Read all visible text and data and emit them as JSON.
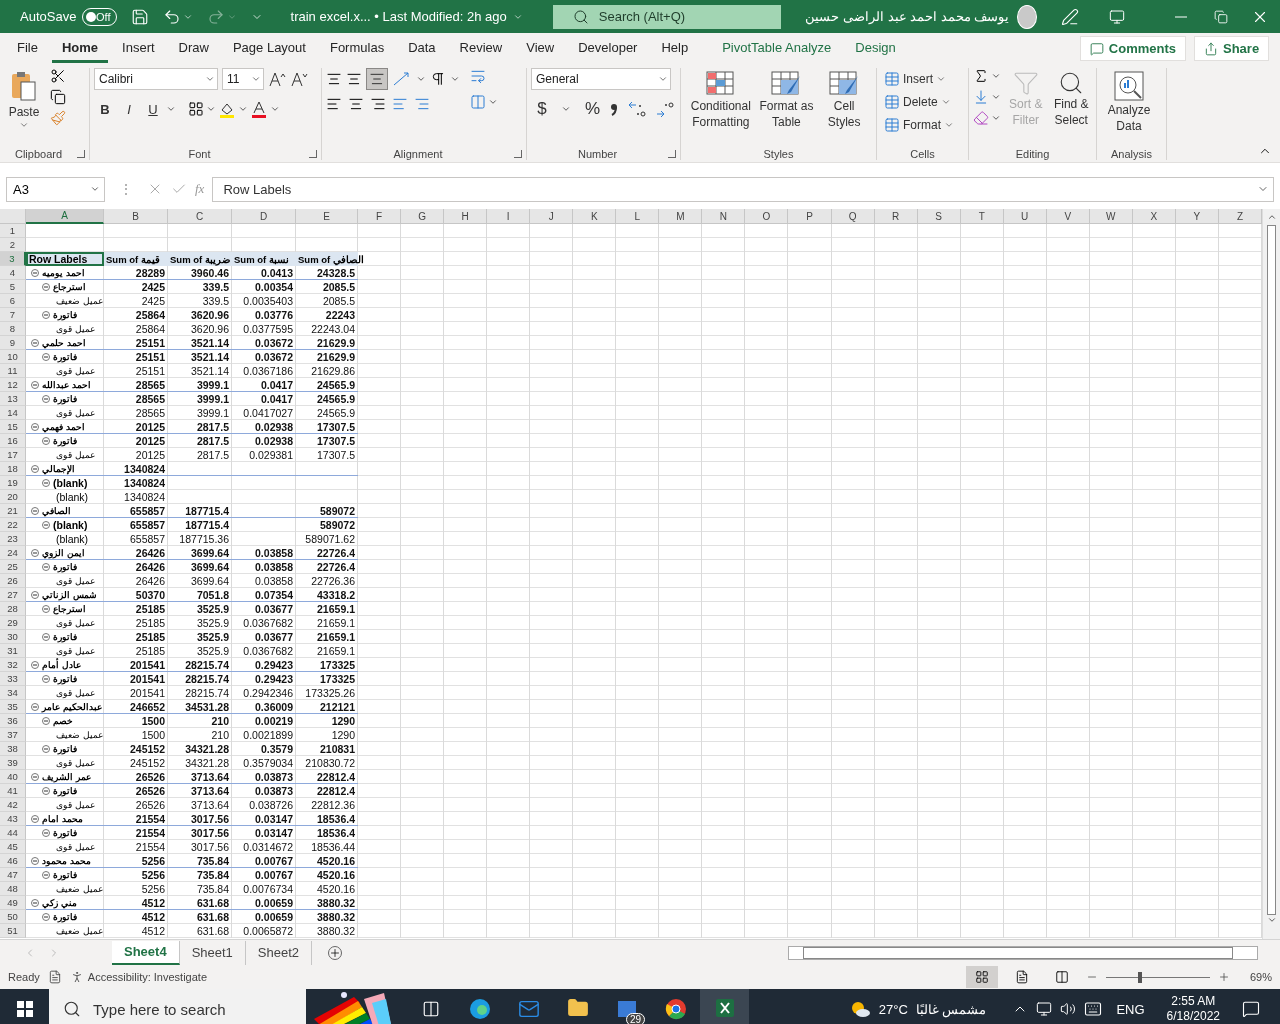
{
  "title_bar": {
    "autosave_label": "AutoSave",
    "autosave_on": false,
    "autosave_state": "Off",
    "file_title": "train excel.x... • Last Modified: 2h ago",
    "search_placeholder": "Search (Alt+Q)",
    "user_name": "يوسف محمد احمد عبد الراضى حسين"
  },
  "ribbon_tabs": [
    {
      "label": "File",
      "selected": false,
      "kind": "standard"
    },
    {
      "label": "Home",
      "selected": true,
      "kind": "standard"
    },
    {
      "label": "Insert",
      "selected": false,
      "kind": "standard"
    },
    {
      "label": "Draw",
      "selected": false,
      "kind": "standard"
    },
    {
      "label": "Page Layout",
      "selected": false,
      "kind": "standard"
    },
    {
      "label": "Formulas",
      "selected": false,
      "kind": "standard"
    },
    {
      "label": "Data",
      "selected": false,
      "kind": "standard"
    },
    {
      "label": "Review",
      "selected": false,
      "kind": "standard"
    },
    {
      "label": "View",
      "selected": false,
      "kind": "standard"
    },
    {
      "label": "Developer",
      "selected": false,
      "kind": "standard"
    },
    {
      "label": "Help",
      "selected": false,
      "kind": "standard"
    },
    {
      "label": "PivotTable Analyze",
      "selected": false,
      "kind": "contextual"
    },
    {
      "label": "Design",
      "selected": false,
      "kind": "contextual"
    }
  ],
  "ribbon_actions": [
    "Comments",
    "Share"
  ],
  "ribbon_groups": [
    {
      "kind": "clipboard",
      "title": "Clipboard",
      "paste": "Paste"
    },
    {
      "kind": "font",
      "title": "Font",
      "font": "Calibri",
      "size": "11",
      "bold": "B",
      "italic": "I",
      "underline": "U"
    },
    {
      "kind": "alignment",
      "title": "Alignment",
      "bottom_align_selected": true
    },
    {
      "kind": "number",
      "title": "Number",
      "format": "General",
      "currency": "$",
      "percent": "%"
    },
    {
      "kind": "styles",
      "title": "Styles",
      "buttons": [
        "Conditional Formatting",
        "Format as Table",
        "Cell Styles"
      ]
    },
    {
      "kind": "cells",
      "title": "Cells",
      "buttons": [
        "Insert",
        "Delete",
        "Format"
      ]
    },
    {
      "kind": "editing",
      "title": "Editing",
      "buttons": [
        {
          "label": "Sort & Filter",
          "disabled": true
        },
        {
          "label": "Find & Select",
          "disabled": false
        }
      ]
    },
    {
      "kind": "analysis",
      "title": "Analysis",
      "buttons": [
        "Analyze Data"
      ]
    }
  ],
  "formula_bar": {
    "name_box": "A3",
    "more": "⋮",
    "fx": "fx",
    "formula": "Row Labels"
  },
  "sheet": {
    "columns": [
      {
        "label": "A",
        "selected": true
      },
      {
        "label": "B",
        "selected": false
      },
      {
        "label": "C",
        "selected": false
      },
      {
        "label": "D",
        "selected": false
      },
      {
        "label": "E",
        "selected": false
      },
      {
        "label": "F",
        "selected": false
      },
      {
        "label": "G",
        "selected": false
      },
      {
        "label": "H",
        "selected": false
      },
      {
        "label": "I",
        "selected": false
      },
      {
        "label": "J",
        "selected": false
      },
      {
        "label": "K",
        "selected": false
      },
      {
        "label": "L",
        "selected": false
      },
      {
        "label": "M",
        "selected": false
      },
      {
        "label": "N",
        "selected": false
      },
      {
        "label": "O",
        "selected": false
      },
      {
        "label": "P",
        "selected": false
      },
      {
        "label": "Q",
        "selected": false
      },
      {
        "label": "R",
        "selected": false
      },
      {
        "label": "S",
        "selected": false
      },
      {
        "label": "T",
        "selected": false
      },
      {
        "label": "U",
        "selected": false
      },
      {
        "label": "V",
        "selected": false
      },
      {
        "label": "W",
        "selected": false
      },
      {
        "label": "X",
        "selected": false
      },
      {
        "label": "Y",
        "selected": false
      },
      {
        "label": "Z",
        "selected": false
      }
    ],
    "empty_rows": [
      "1",
      "2"
    ],
    "header_row": {
      "row": "3",
      "selected": true,
      "cells": [
        "Row Labels",
        "Sum of قيمة",
        "Sum of ضريبة",
        "Sum of نسبة",
        "Sum of الصافي"
      ]
    },
    "pivot_rows": [
      {
        "row": "4",
        "label": "احمد يوميه",
        "expanded": true,
        "values": {
          "B": "28289",
          "C": "3960.46",
          "D": "0.0413",
          "E": "24328.5"
        },
        "children": [
          {
            "row": "5",
            "label": "استرجاع",
            "expanded": true,
            "values": {
              "B": "2425",
              "C": "339.5",
              "D": "0.00354",
              "E": "2085.5"
            },
            "children": [
              {
                "row": "6",
                "label": "عميل ضعيف",
                "values": {
                  "B": "2425",
                  "C": "339.5",
                  "D": "0.0035403",
                  "E": "2085.5"
                }
              }
            ]
          },
          {
            "row": "7",
            "label": "فاتورة",
            "expanded": true,
            "values": {
              "B": "25864",
              "C": "3620.96",
              "D": "0.03776",
              "E": "22243"
            },
            "children": [
              {
                "row": "8",
                "label": "عميل قوى",
                "values": {
                  "B": "25864",
                  "C": "3620.96",
                  "D": "0.0377595",
                  "E": "22243.04"
                }
              }
            ]
          }
        ]
      },
      {
        "row": "9",
        "label": "احمد حلمي",
        "expanded": true,
        "values": {
          "B": "25151",
          "C": "3521.14",
          "D": "0.03672",
          "E": "21629.9"
        },
        "children": [
          {
            "row": "10",
            "label": "فاتورة",
            "expanded": true,
            "values": {
              "B": "25151",
              "C": "3521.14",
              "D": "0.03672",
              "E": "21629.9"
            },
            "children": [
              {
                "row": "11",
                "label": "عميل قوى",
                "values": {
                  "B": "25151",
                  "C": "3521.14",
                  "D": "0.0367186",
                  "E": "21629.86"
                }
              }
            ]
          }
        ]
      },
      {
        "row": "12",
        "label": "احمد عبدالله",
        "expanded": true,
        "values": {
          "B": "28565",
          "C": "3999.1",
          "D": "0.0417",
          "E": "24565.9"
        },
        "children": [
          {
            "row": "13",
            "label": "فاتورة",
            "expanded": true,
            "values": {
              "B": "28565",
              "C": "3999.1",
              "D": "0.0417",
              "E": "24565.9"
            },
            "children": [
              {
                "row": "14",
                "label": "عميل قوى",
                "values": {
                  "B": "28565",
                  "C": "3999.1",
                  "D": "0.0417027",
                  "E": "24565.9"
                }
              }
            ]
          }
        ]
      },
      {
        "row": "15",
        "label": "احمد فهمي",
        "expanded": true,
        "values": {
          "B": "20125",
          "C": "2817.5",
          "D": "0.02938",
          "E": "17307.5"
        },
        "children": [
          {
            "row": "16",
            "label": "فاتورة",
            "expanded": true,
            "values": {
              "B": "20125",
              "C": "2817.5",
              "D": "0.02938",
              "E": "17307.5"
            },
            "children": [
              {
                "row": "17",
                "label": "عميل قوى",
                "values": {
                  "B": "20125",
                  "C": "2817.5",
                  "D": "0.029381",
                  "E": "17307.5"
                }
              }
            ]
          }
        ]
      },
      {
        "row": "18",
        "label": "الإجمالي",
        "expanded": true,
        "values": {
          "B": "1340824"
        },
        "children": [
          {
            "row": "19",
            "label": "(blank)",
            "expanded": true,
            "values": {
              "B": "1340824"
            },
            "children": [
              {
                "row": "20",
                "label": "(blank)",
                "values": {
                  "B": "1340824"
                }
              }
            ]
          }
        ]
      },
      {
        "row": "21",
        "label": "الصافي",
        "expanded": true,
        "values": {
          "B": "655857",
          "C": "187715.4",
          "E": "589072"
        },
        "children": [
          {
            "row": "22",
            "label": "(blank)",
            "expanded": true,
            "values": {
              "B": "655857",
              "C": "187715.4",
              "E": "589072"
            },
            "children": [
              {
                "row": "23",
                "label": "(blank)",
                "values": {
                  "B": "655857",
                  "C": "187715.36",
                  "E": "589071.62"
                }
              }
            ]
          }
        ]
      },
      {
        "row": "24",
        "label": "ايمن الزوي",
        "expanded": true,
        "values": {
          "B": "26426",
          "C": "3699.64",
          "D": "0.03858",
          "E": "22726.4"
        },
        "children": [
          {
            "row": "25",
            "label": "فاتورة",
            "expanded": true,
            "values": {
              "B": "26426",
              "C": "3699.64",
              "D": "0.03858",
              "E": "22726.4"
            },
            "children": [
              {
                "row": "26",
                "label": "عميل قوى",
                "values": {
                  "B": "26426",
                  "C": "3699.64",
                  "D": "0.03858",
                  "E": "22726.36"
                }
              }
            ]
          }
        ]
      },
      {
        "row": "27",
        "label": "شمس الزناتي",
        "expanded": true,
        "values": {
          "B": "50370",
          "C": "7051.8",
          "D": "0.07354",
          "E": "43318.2"
        },
        "children": [
          {
            "row": "28",
            "label": "استرجاع",
            "expanded": true,
            "values": {
              "B": "25185",
              "C": "3525.9",
              "D": "0.03677",
              "E": "21659.1"
            },
            "children": [
              {
                "row": "29",
                "label": "عميل قوى",
                "values": {
                  "B": "25185",
                  "C": "3525.9",
                  "D": "0.0367682",
                  "E": "21659.1"
                }
              }
            ]
          },
          {
            "row": "30",
            "label": "فاتورة",
            "expanded": true,
            "values": {
              "B": "25185",
              "C": "3525.9",
              "D": "0.03677",
              "E": "21659.1"
            },
            "children": [
              {
                "row": "31",
                "label": "عميل قوى",
                "values": {
                  "B": "25185",
                  "C": "3525.9",
                  "D": "0.0367682",
                  "E": "21659.1"
                }
              }
            ]
          }
        ]
      },
      {
        "row": "32",
        "label": "عادل أمام",
        "expanded": true,
        "values": {
          "B": "201541",
          "C": "28215.74",
          "D": "0.29423",
          "E": "173325"
        },
        "children": [
          {
            "row": "33",
            "label": "فاتورة",
            "expanded": true,
            "values": {
              "B": "201541",
              "C": "28215.74",
              "D": "0.29423",
              "E": "173325"
            },
            "children": [
              {
                "row": "34",
                "label": "عميل قوى",
                "values": {
                  "B": "201541",
                  "C": "28215.74",
                  "D": "0.2942346",
                  "E": "173325.26"
                }
              }
            ]
          }
        ]
      },
      {
        "row": "35",
        "label": "عبدالحكيم عامر",
        "expanded": true,
        "values": {
          "B": "246652",
          "C": "34531.28",
          "D": "0.36009",
          "E": "212121"
        },
        "children": [
          {
            "row": "36",
            "label": "خصم",
            "expanded": true,
            "values": {
              "B": "1500",
              "C": "210",
              "D": "0.00219",
              "E": "1290"
            },
            "children": [
              {
                "row": "37",
                "label": "عميل ضعيف",
                "values": {
                  "B": "1500",
                  "C": "210",
                  "D": "0.0021899",
                  "E": "1290"
                }
              }
            ]
          },
          {
            "row": "38",
            "label": "فاتورة",
            "expanded": true,
            "values": {
              "B": "245152",
              "C": "34321.28",
              "D": "0.3579",
              "E": "210831"
            },
            "children": [
              {
                "row": "39",
                "label": "عميل قوى",
                "values": {
                  "B": "245152",
                  "C": "34321.28",
                  "D": "0.3579034",
                  "E": "210830.72"
                }
              }
            ]
          }
        ]
      },
      {
        "row": "40",
        "label": "عمر الشريف",
        "expanded": true,
        "values": {
          "B": "26526",
          "C": "3713.64",
          "D": "0.03873",
          "E": "22812.4"
        },
        "children": [
          {
            "row": "41",
            "label": "فاتورة",
            "expanded": true,
            "values": {
              "B": "26526",
              "C": "3713.64",
              "D": "0.03873",
              "E": "22812.4"
            },
            "children": [
              {
                "row": "42",
                "label": "عميل قوى",
                "values": {
                  "B": "26526",
                  "C": "3713.64",
                  "D": "0.038726",
                  "E": "22812.36"
                }
              }
            ]
          }
        ]
      },
      {
        "row": "43",
        "label": "محمد امام",
        "expanded": true,
        "values": {
          "B": "21554",
          "C": "3017.56",
          "D": "0.03147",
          "E": "18536.4"
        },
        "children": [
          {
            "row": "44",
            "label": "فاتورة",
            "expanded": true,
            "values": {
              "B": "21554",
              "C": "3017.56",
              "D": "0.03147",
              "E": "18536.4"
            },
            "children": [
              {
                "row": "45",
                "label": "عميل قوى",
                "values": {
                  "B": "21554",
                  "C": "3017.56",
                  "D": "0.0314672",
                  "E": "18536.44"
                }
              }
            ]
          }
        ]
      },
      {
        "row": "46",
        "label": "محمد محمود",
        "expanded": true,
        "values": {
          "B": "5256",
          "C": "735.84",
          "D": "0.00767",
          "E": "4520.16"
        },
        "children": [
          {
            "row": "47",
            "label": "فاتورة",
            "expanded": true,
            "values": {
              "B": "5256",
              "C": "735.84",
              "D": "0.00767",
              "E": "4520.16"
            },
            "children": [
              {
                "row": "48",
                "label": "عميل ضعيف",
                "values": {
                  "B": "5256",
                  "C": "735.84",
                  "D": "0.0076734",
                  "E": "4520.16"
                }
              }
            ]
          }
        ]
      },
      {
        "row": "49",
        "label": "مني زكي",
        "expanded": true,
        "values": {
          "B": "4512",
          "C": "631.68",
          "D": "0.00659",
          "E": "3880.32"
        },
        "children": [
          {
            "row": "50",
            "label": "فاتورة",
            "expanded": true,
            "values": {
              "B": "4512",
              "C": "631.68",
              "D": "0.00659",
              "E": "3880.32"
            },
            "children": [
              {
                "row": "51",
                "label": "عميل ضعيف",
                "values": {
                  "B": "4512",
                  "C": "631.68",
                  "D": "0.0065872",
                  "E": "3880.32"
                }
              }
            ]
          }
        ]
      }
    ]
  },
  "sheet_tabs": [
    {
      "label": "Sheet4",
      "selected": true
    },
    {
      "label": "Sheet1",
      "selected": false
    },
    {
      "label": "Sheet2",
      "selected": false
    }
  ],
  "status_bar": {
    "ready": "Ready",
    "accessibility": "Accessibility: Investigate",
    "zoom": "69%",
    "level": 0.33
  },
  "taskbar": {
    "search_placeholder": "Type here to search",
    "badge": "29",
    "temperature": "27°C",
    "weather": "مشمس غالبًا",
    "language": "ENG",
    "time": "2:55 AM",
    "date": "6/18/2022"
  }
}
